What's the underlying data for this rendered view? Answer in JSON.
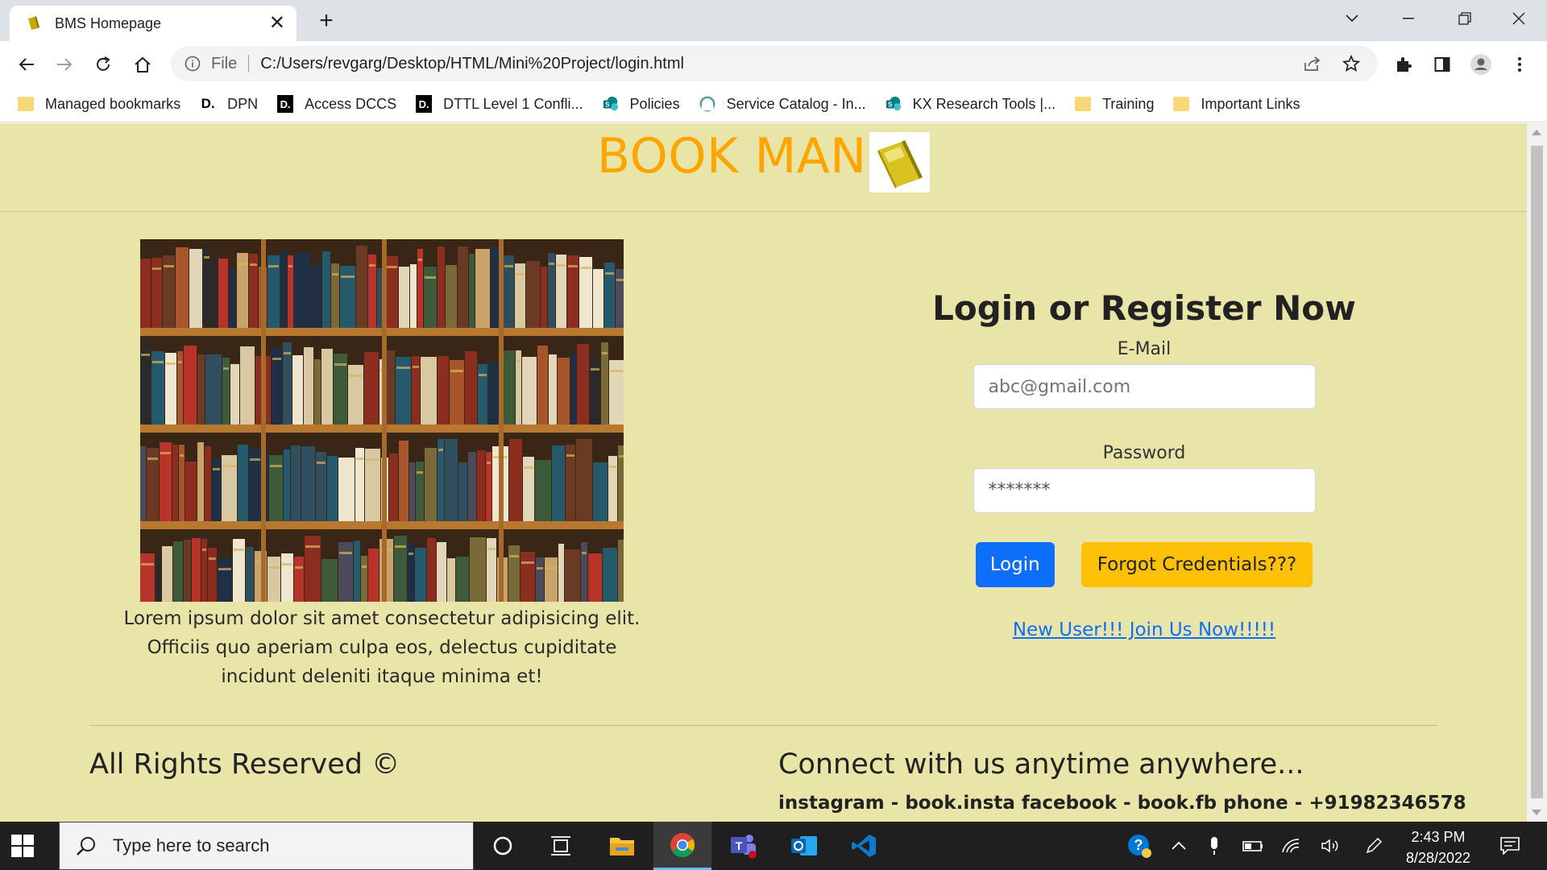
{
  "browser": {
    "tab_title": "BMS Homepage",
    "omnibox_scheme": "File",
    "url": "C:/Users/revgarg/Desktop/HTML/Mini%20Project/login.html",
    "bookmarks": [
      {
        "label": "Managed bookmarks",
        "icon": "folder-icon"
      },
      {
        "label": "DPN",
        "icon": "d-logo-icon"
      },
      {
        "label": "Access DCCS",
        "icon": "d-logo-icon"
      },
      {
        "label": "DTTL Level 1 Confli...",
        "icon": "d-logo-icon"
      },
      {
        "label": "Policies",
        "icon": "sharepoint-icon"
      },
      {
        "label": "Service Catalog - In...",
        "icon": "service-catalog-icon"
      },
      {
        "label": "KX Research Tools |...",
        "icon": "sharepoint-icon"
      },
      {
        "label": "Training",
        "icon": "folder-icon"
      },
      {
        "label": "Important Links",
        "icon": "folder-icon"
      }
    ],
    "bookmark_d_text": "D."
  },
  "page": {
    "brand": "BOOK MAN",
    "hero_caption": "Lorem ipsum dolor sit amet consectetur adipisicing elit. Officiis quo aperiam culpa eos, delectus cupiditate incidunt deleniti itaque minima et!",
    "login": {
      "title": "Login or Register Now",
      "email_label": "E-Mail",
      "email_placeholder": "abc@gmail.com",
      "password_label": "Password",
      "password_value": "*******",
      "login_button": "Login",
      "forgot_button": "Forgot Credentials???",
      "join_link": "New User!!! Join Us Now!!!!!"
    },
    "footer": {
      "rights": "All Rights Reserved ©",
      "connect_title": "Connect with us anytime anywhere...",
      "contacts": "instagram - book.insta facebook - book.fb phone - +91982346578"
    }
  },
  "taskbar": {
    "search_placeholder": "Type here to search",
    "time": "2:43 PM",
    "date": "8/28/2022"
  },
  "colors": {
    "page_bg": "#e9e5a9",
    "brand": "#ffa500",
    "login_button": "#0d6efd",
    "forgot_button": "#ffc107"
  }
}
